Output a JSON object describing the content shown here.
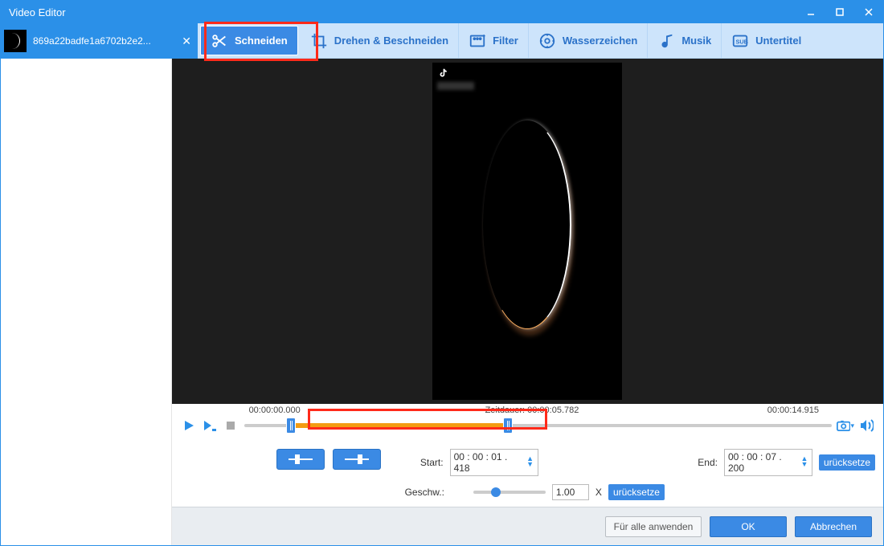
{
  "window": {
    "title": "Video Editor"
  },
  "file_tab": {
    "name": "869a22badfe1a6702b2e2..."
  },
  "toolbar": {
    "schneiden": "Schneiden",
    "drehen": "Drehen & Beschneiden",
    "filter": "Filter",
    "wasserzeichen": "Wasserzeichen",
    "musik": "Musik",
    "untertitel": "Untertitel"
  },
  "timeline": {
    "start_label": "00:00:00.000",
    "duration_label": "Zeitdauer: 00:00:05.782",
    "end_label": "00:00:14.915"
  },
  "fields": {
    "start_label": "Start:",
    "start_value": "00 : 00 : 01 . 418",
    "end_label": "End:",
    "end_value": "00 : 00 : 07 . 200",
    "reset": "urücksetze",
    "speed_label": "Geschw.:",
    "speed_value": "1.00",
    "speed_suffix": "X"
  },
  "footer": {
    "apply_all": "Für alle anwenden",
    "ok": "OK",
    "cancel": "Abbrechen"
  },
  "icons": {
    "tiktok_label": ""
  }
}
